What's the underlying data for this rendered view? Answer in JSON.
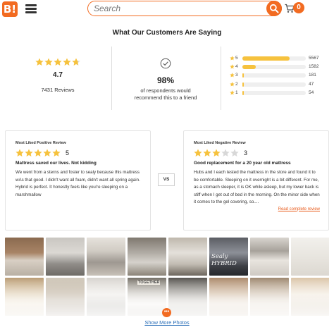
{
  "header": {
    "logo_text": "B!",
    "search_placeholder": "Search",
    "cart_count": "0",
    "colors": {
      "accent": "#f26b21"
    }
  },
  "section_title": "What Our Customers Are Saying",
  "summary": {
    "average_rating": "4.7",
    "average_stars": 4.7,
    "total_reviews": "7431 Reviews",
    "recommend_pct": "98%",
    "recommend_text_1": "of respondents would",
    "recommend_text_2": "recommend this to a friend"
  },
  "distribution": [
    {
      "stars": "5",
      "count": "5567",
      "fraction": 0.749
    },
    {
      "stars": "4",
      "count": "1582",
      "fraction": 0.213
    },
    {
      "stars": "3",
      "count": "181",
      "fraction": 0.024
    },
    {
      "stars": "2",
      "count": "47",
      "fraction": 0.006
    },
    {
      "stars": "1",
      "count": "54",
      "fraction": 0.007
    }
  ],
  "positive_review": {
    "kicker": "Most Liked Positive Review",
    "rating": "5",
    "stars": 5,
    "headline": "Mattress saved our lives. Not kidding",
    "body": "We went from a sterns and foster to sealy because this mattress wAs that good. I didn't want all foam, didn't want all spring again. Hybrid is perfect. It honestly feels like you're sleeping on a marshmallow"
  },
  "vs_label": "VS",
  "negative_review": {
    "kicker": "Most Liked Negative Review",
    "rating": "3",
    "stars": 3,
    "headline": "Good replacement for a 20 year old mattress",
    "body": "Hubs and I each tested the mattress in the store and found it to be comfortable. Sleeping on it overnight is a bit different. For me, as a stomach sleeper, it is OK while asleep, but my lower back is stiff when I get out of bed in the morning. On the minor side when it comes to the gel covering, so....",
    "read_more": "Read complete review"
  },
  "photos": {
    "count_visible": 16,
    "embedded_text": [
      "Sealy HYBRID",
      "TOGETHER"
    ],
    "show_more": "Show More Photos",
    "more_icon": "ellipsis-icon"
  }
}
